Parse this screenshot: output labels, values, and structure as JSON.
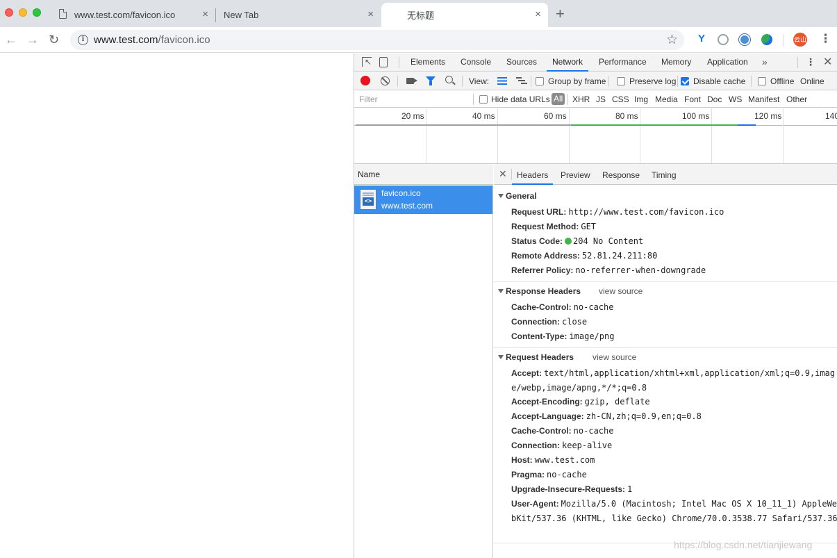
{
  "browser": {
    "tabs": [
      {
        "title": "www.test.com/favicon.ico",
        "close": "×"
      },
      {
        "title": "New Tab",
        "close": "×"
      },
      {
        "title": "无标题",
        "close": "×"
      }
    ],
    "new_tab": "+",
    "url_host": "www.test.com",
    "url_path": "/favicon.ico",
    "avatar_text": "云山"
  },
  "devtools": {
    "tabs": [
      "Elements",
      "Console",
      "Sources",
      "Network",
      "Performance",
      "Memory",
      "Application"
    ],
    "active_tab": "Network",
    "more": "»",
    "close": "✕",
    "toolbar": {
      "view_label": "View:",
      "group_by_frame": "Group by frame",
      "preserve_log": "Preserve log",
      "disable_cache": "Disable cache",
      "offline": "Offline",
      "throttle": "Online"
    },
    "filter": {
      "placeholder": "Filter",
      "hide_data_urls": "Hide data URLs",
      "types": [
        "All",
        "XHR",
        "JS",
        "CSS",
        "Img",
        "Media",
        "Font",
        "Doc",
        "WS",
        "Manifest",
        "Other"
      ]
    },
    "overview_ticks": [
      "20 ms",
      "40 ms",
      "60 ms",
      "80 ms",
      "100 ms",
      "120 ms",
      "140"
    ],
    "name_header": "Name",
    "request": {
      "name": "favicon.ico",
      "domain": "www.test.com"
    },
    "detail_tabs": [
      "Headers",
      "Preview",
      "Response",
      "Timing"
    ],
    "view_source": "view source",
    "general": {
      "title": "General",
      "rows": [
        {
          "key": "Request URL:",
          "value": "http://www.test.com/favicon.ico"
        },
        {
          "key": "Request Method:",
          "value": "GET"
        },
        {
          "key": "Status Code:",
          "value": "204 No Content"
        },
        {
          "key": "Remote Address:",
          "value": "52.81.24.211:80"
        },
        {
          "key": "Referrer Policy:",
          "value": "no-referrer-when-downgrade"
        }
      ]
    },
    "response_headers": {
      "title": "Response Headers",
      "rows": [
        {
          "key": "Cache-Control:",
          "value": "no-cache"
        },
        {
          "key": "Connection:",
          "value": "close"
        },
        {
          "key": "Content-Type:",
          "value": "image/png"
        }
      ]
    },
    "request_headers": {
      "title": "Request Headers",
      "rows": [
        {
          "key": "Accept:",
          "value": "text/html,application/xhtml+xml,application/xml;q=0.9,image/webp,image/apng,*/*;q=0.8"
        },
        {
          "key": "Accept-Encoding:",
          "value": "gzip, deflate"
        },
        {
          "key": "Accept-Language:",
          "value": "zh-CN,zh;q=0.9,en;q=0.8"
        },
        {
          "key": "Cache-Control:",
          "value": "no-cache"
        },
        {
          "key": "Connection:",
          "value": "keep-alive"
        },
        {
          "key": "Host:",
          "value": "www.test.com"
        },
        {
          "key": "Pragma:",
          "value": "no-cache"
        },
        {
          "key": "Upgrade-Insecure-Requests:",
          "value": "1"
        },
        {
          "key": "User-Agent:",
          "value": "Mozilla/5.0 (Macintosh; Intel Mac OS X 10_11_1) AppleWebKit/537.36 (KHTML, like Gecko) Chrome/70.0.3538.77 Safari/537.36"
        }
      ]
    }
  },
  "watermark": "https://blog.csdn.net/tianjiewang",
  "colors": {
    "accent": "#1a73e8",
    "selected_row": "#3b8eea",
    "record": "#e8131c",
    "status_ok": "#3fb54a"
  }
}
